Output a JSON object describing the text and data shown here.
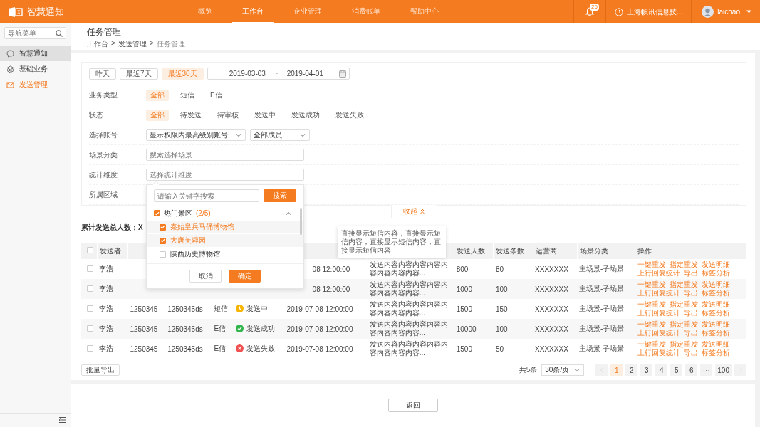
{
  "topbar": {
    "logo_text": "智慧通知",
    "nav": [
      {
        "label": "概览",
        "selected": false
      },
      {
        "label": "工作台",
        "selected": true
      },
      {
        "label": "企业管理",
        "selected": false
      },
      {
        "label": "消费账单",
        "selected": false
      },
      {
        "label": "帮助中心",
        "selected": false
      }
    ],
    "notification_badge": "26",
    "company": "上海帜讯信息技...",
    "user": "laichao"
  },
  "sidebar": {
    "search_placeholder": "导航菜单",
    "items": [
      {
        "label": "智慧通知",
        "selected": false,
        "hovered": true
      },
      {
        "label": "基础业务",
        "selected": false,
        "hovered": false
      },
      {
        "label": "发送管理",
        "selected": true,
        "hovered": false
      }
    ]
  },
  "page": {
    "title": "任务管理",
    "breadcrumb": [
      "工作台",
      "发送管理",
      "任务管理"
    ],
    "breadcrumb_separator": ">"
  },
  "filters": {
    "quick_ranges": [
      {
        "label": "昨天",
        "selected": false
      },
      {
        "label": "最近7天",
        "selected": false
      },
      {
        "label": "最近30天",
        "selected": true
      }
    ],
    "date_range": {
      "start": "2019-03-03",
      "separator": "~",
      "end": "2019-04-01"
    },
    "rows": [
      {
        "kind": "chips",
        "label": "业务类型",
        "options": [
          {
            "label": "全部",
            "selected": true
          },
          {
            "label": "短信",
            "selected": false
          },
          {
            "label": "E信",
            "selected": false
          }
        ]
      },
      {
        "kind": "chips",
        "label": "状态",
        "options": [
          {
            "label": "全部",
            "selected": true
          },
          {
            "label": "待发送",
            "selected": false
          },
          {
            "label": "待审核",
            "selected": false
          },
          {
            "label": "发送中",
            "selected": false
          },
          {
            "label": "发送成功",
            "selected": false
          },
          {
            "label": "发送失败",
            "selected": false
          }
        ]
      },
      {
        "kind": "selects",
        "label": "选择账号",
        "selects": [
          "显示权限内最高级别账号",
          "全部成员"
        ]
      },
      {
        "kind": "input",
        "label": "场景分类",
        "placeholder": "搜索选择场景"
      },
      {
        "kind": "input",
        "label": "统计维度",
        "placeholder": "选择统计维度",
        "popup": {
          "search_placeholder": "请输入关键字搜索",
          "search_button": "搜索",
          "group": {
            "label": "热门景区",
            "count": "(2/5)",
            "checked": true,
            "expanded": true,
            "items": [
              {
                "label": "秦始皇兵马俑博物馆",
                "checked": true
              },
              {
                "label": "大唐芙蓉园",
                "checked": true
              },
              {
                "label": "陕西历史博物馆",
                "checked": false
              }
            ]
          },
          "buttons": [
            {
              "label": "取消",
              "kind": "default"
            },
            {
              "label": "确定",
              "kind": "primary"
            }
          ]
        }
      },
      {
        "kind": "empty",
        "label": "所属区域"
      }
    ],
    "collapse": "收起"
  },
  "summary": "累计发送总人数：X",
  "table": {
    "header_checked": false,
    "columns": [
      {
        "kind": "text",
        "label": "发送者"
      },
      {
        "kind": "covered"
      },
      {
        "kind": "covered"
      },
      {
        "kind": "covered"
      },
      {
        "kind": "covered"
      },
      {
        "kind": "covered"
      },
      {
        "kind": "covered",
        "tooltip": "直接显示短信内容，直接显示短信内容，直接显示短信内容，直接显示短信内容"
      },
      {
        "kind": "text",
        "label": "发送人数"
      },
      {
        "kind": "text",
        "label": "发送条数"
      },
      {
        "kind": "text",
        "label": "运营商"
      },
      {
        "kind": "text",
        "label": "场景分类"
      },
      {
        "kind": "text",
        "label": "操作"
      }
    ],
    "rows": [
      {
        "checked": false,
        "cells": [
          {
            "kind": "text",
            "text": "李浩"
          },
          {
            "kind": "covered"
          },
          {
            "kind": "covered"
          },
          {
            "kind": "covered"
          },
          {
            "kind": "covered"
          },
          {
            "kind": "cut",
            "text": "08 12:00:00"
          },
          {
            "kind": "content",
            "text": "发送内容内容内容内容内容内容内容内容..."
          },
          {
            "kind": "text",
            "text": "800"
          },
          {
            "kind": "text",
            "text": "80"
          },
          {
            "kind": "text",
            "text": "XXXXXXX"
          },
          {
            "kind": "text",
            "text": "主场景-子场景"
          },
          {
            "kind": "actions",
            "links": [
              "一键重发",
              "指定重发",
              "发送明细",
              "上行回复统计",
              "导出",
              "标签分析"
            ]
          }
        ]
      },
      {
        "checked": false,
        "cells": [
          {
            "kind": "text",
            "text": "李浩"
          },
          {
            "kind": "covered"
          },
          {
            "kind": "covered"
          },
          {
            "kind": "covered"
          },
          {
            "kind": "covered"
          },
          {
            "kind": "cut",
            "text": "08 12:00:00"
          },
          {
            "kind": "content",
            "text": "发送内容内容内容内容内容内容内容内容..."
          },
          {
            "kind": "text",
            "text": "1000"
          },
          {
            "kind": "text",
            "text": "100"
          },
          {
            "kind": "text",
            "text": "XXXXXXX"
          },
          {
            "kind": "text",
            "text": "主场景-子场景"
          },
          {
            "kind": "actions",
            "links": [
              "一键重发",
              "指定重发",
              "发送明细",
              "上行回复统计",
              "导出",
              "标签分析"
            ]
          }
        ]
      },
      {
        "checked": false,
        "cells": [
          {
            "kind": "text",
            "text": "李浩"
          },
          {
            "kind": "text",
            "text": "1250345"
          },
          {
            "kind": "text",
            "text": "1250345ds"
          },
          {
            "kind": "text",
            "text": "短信"
          },
          {
            "kind": "pending",
            "text": "发送中"
          },
          {
            "kind": "text",
            "text": "2019-07-08 12:00:00"
          },
          {
            "kind": "content",
            "text": "发送内容内容内容内容内容内容内容内容..."
          },
          {
            "kind": "text",
            "text": "1500"
          },
          {
            "kind": "text",
            "text": "150"
          },
          {
            "kind": "text",
            "text": "XXXXXXX"
          },
          {
            "kind": "text",
            "text": "主场景-子场景"
          },
          {
            "kind": "actions",
            "links": [
              "一键重发",
              "指定重发",
              "发送明细",
              "上行回复统计",
              "导出",
              "标签分析"
            ]
          }
        ]
      },
      {
        "checked": false,
        "cells": [
          {
            "kind": "text",
            "text": "李浩"
          },
          {
            "kind": "text",
            "text": "1250345"
          },
          {
            "kind": "text",
            "text": "1250345ds"
          },
          {
            "kind": "text",
            "text": "E信"
          },
          {
            "kind": "success",
            "text": "发送成功"
          },
          {
            "kind": "text",
            "text": "2019-07-08 12:00:00"
          },
          {
            "kind": "content",
            "text": "发送内容内容内容内容内容内容内容内容..."
          },
          {
            "kind": "text",
            "text": "10000"
          },
          {
            "kind": "text",
            "text": "100"
          },
          {
            "kind": "text",
            "text": "XXXXXXX"
          },
          {
            "kind": "text",
            "text": "主场景-子场景"
          },
          {
            "kind": "actions",
            "links": [
              "一键重发",
              "指定重发",
              "发送明细",
              "上行回复统计",
              "导出",
              "标签分析"
            ]
          }
        ]
      },
      {
        "checked": false,
        "cells": [
          {
            "kind": "text",
            "text": "李浩"
          },
          {
            "kind": "text",
            "text": "1250345"
          },
          {
            "kind": "text",
            "text": "1250345ds"
          },
          {
            "kind": "text",
            "text": "E信"
          },
          {
            "kind": "failure",
            "text": "发送失败"
          },
          {
            "kind": "text",
            "text": "2019-07-08 12:00:00"
          },
          {
            "kind": "content",
            "text": "发送内容内容内容内容内容内容内容内容..."
          },
          {
            "kind": "text",
            "text": "1500"
          },
          {
            "kind": "text",
            "text": "50"
          },
          {
            "kind": "text",
            "text": "XXXXXXX"
          },
          {
            "kind": "text",
            "text": "主场景-子场景"
          },
          {
            "kind": "actions",
            "links": [
              "一键重发",
              "指定重发",
              "发送明细",
              "上行回复统计",
              "导出",
              "标签分析"
            ]
          }
        ]
      }
    ]
  },
  "bulk_export": "批量导出",
  "pagination": {
    "total": "共5条",
    "page_size": "30条/页",
    "prev_disabled": true,
    "next_disabled": true,
    "pages": [
      {
        "label": "1",
        "selected": true
      },
      {
        "label": "2",
        "selected": false
      },
      {
        "label": "3",
        "selected": false
      },
      {
        "label": "4",
        "selected": false
      },
      {
        "label": "5",
        "selected": false
      },
      {
        "label": "6",
        "selected": false
      },
      {
        "label": "···",
        "selected": false
      },
      {
        "label": "100",
        "selected": false
      }
    ]
  },
  "back_button": "返回"
}
